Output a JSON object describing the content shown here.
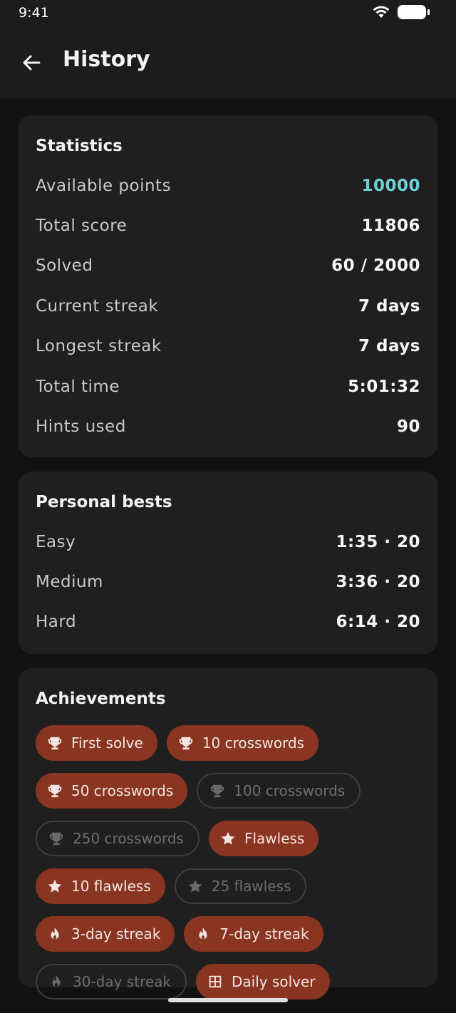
{
  "status_bar": {
    "time": "9:41"
  },
  "app_bar": {
    "title": "History"
  },
  "statistics": {
    "title": "Statistics",
    "rows": [
      {
        "label": "Available points",
        "value": "10000"
      },
      {
        "label": "Total score",
        "value": "11806"
      },
      {
        "label": "Solved",
        "value": "60 / 2000"
      },
      {
        "label": "Current streak",
        "value": "7 days"
      },
      {
        "label": "Longest streak",
        "value": "7 days"
      },
      {
        "label": "Total time",
        "value": "5:01:32"
      },
      {
        "label": "Hints used",
        "value": "90"
      }
    ],
    "accent_color": "#6fd1d6"
  },
  "personal_bests": {
    "title": "Personal bests",
    "rows": [
      {
        "label": "Easy",
        "value": "1:35 · 20"
      },
      {
        "label": "Medium",
        "value": "3:36 · 20"
      },
      {
        "label": "Hard",
        "value": "6:14 · 20"
      }
    ]
  },
  "achievements": {
    "title": "Achievements",
    "earned_color": "#8a3522",
    "items": [
      {
        "label": "First solve",
        "icon": "trophy-icon",
        "earned": true
      },
      {
        "label": "10 crosswords",
        "icon": "trophy-icon",
        "earned": true
      },
      {
        "label": "50 crosswords",
        "icon": "trophy-icon",
        "earned": true
      },
      {
        "label": "100 crosswords",
        "icon": "trophy-icon",
        "earned": false
      },
      {
        "label": "250 crosswords",
        "icon": "trophy-icon",
        "earned": false
      },
      {
        "label": "Flawless",
        "icon": "star-icon",
        "earned": true
      },
      {
        "label": "10 flawless",
        "icon": "star-icon",
        "earned": true
      },
      {
        "label": "25 flawless",
        "icon": "star-icon",
        "earned": false
      },
      {
        "label": "3-day streak",
        "icon": "flame-icon",
        "earned": true
      },
      {
        "label": "7-day streak",
        "icon": "flame-icon",
        "earned": true
      },
      {
        "label": "30-day streak",
        "icon": "flame-icon",
        "earned": false
      },
      {
        "label": "Daily solver",
        "icon": "calendar-grid-icon",
        "earned": true
      }
    ]
  }
}
